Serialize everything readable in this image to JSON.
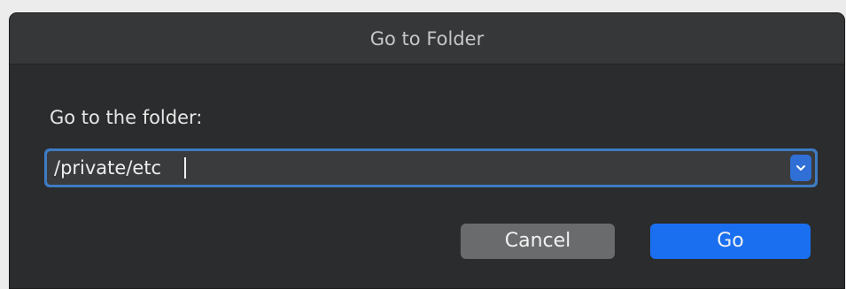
{
  "dialog": {
    "title": "Go to Folder",
    "prompt_label": "Go to the folder:",
    "path_value": "/private/etc",
    "dropdown_icon": "chevron-down-icon",
    "cancel_label": "Cancel",
    "go_label": "Go"
  },
  "colors": {
    "dialog_bg": "#2b2c2d",
    "titlebar_bg": "#363738",
    "focus_ring": "#3e7bc4",
    "primary_button": "#1a6ff0",
    "secondary_button": "#6a6b6c"
  }
}
